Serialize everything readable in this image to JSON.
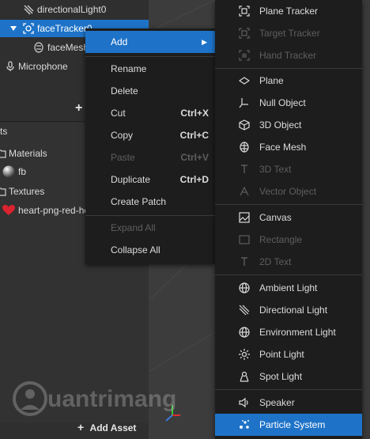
{
  "scene": {
    "items": [
      {
        "label": "directionalLight0"
      },
      {
        "label": "faceTracker0"
      },
      {
        "label": "faceMesh"
      },
      {
        "label": "Microphone"
      }
    ],
    "add_glyph": "+"
  },
  "assets": {
    "header_fragment": "ts",
    "items": [
      {
        "label": "Materials"
      },
      {
        "label": "fb"
      },
      {
        "label": "Textures"
      },
      {
        "label": "heart-png-red-he"
      }
    ],
    "add_label": "Add Asset"
  },
  "context_menu": {
    "add": "Add",
    "add_arrow": "▶",
    "items": [
      {
        "label": "Rename",
        "shortcut": ""
      },
      {
        "label": "Delete",
        "shortcut": ""
      },
      {
        "label": "Cut",
        "shortcut": "Ctrl+X"
      },
      {
        "label": "Copy",
        "shortcut": "Ctrl+C"
      },
      {
        "label": "Paste",
        "shortcut": "Ctrl+V"
      },
      {
        "label": "Duplicate",
        "shortcut": "Ctrl+D"
      },
      {
        "label": "Create Patch",
        "shortcut": ""
      },
      {
        "label": "Expand All",
        "shortcut": ""
      },
      {
        "label": "Collapse All",
        "shortcut": ""
      }
    ]
  },
  "submenu": {
    "items": [
      {
        "label": "Plane Tracker",
        "icon": "plane-tracker-icon"
      },
      {
        "label": "Target Tracker",
        "icon": "target-tracker-icon"
      },
      {
        "label": "Hand Tracker",
        "icon": "hand-tracker-icon"
      },
      {
        "label": "Plane",
        "icon": "plane-icon"
      },
      {
        "label": "Null Object",
        "icon": "null-object-icon"
      },
      {
        "label": "3D Object",
        "icon": "cube-icon"
      },
      {
        "label": "Face Mesh",
        "icon": "face-mesh-icon"
      },
      {
        "label": "3D Text",
        "icon": "text-icon"
      },
      {
        "label": "Vector Object",
        "icon": "vector-object-icon"
      },
      {
        "label": "Canvas",
        "icon": "canvas-icon"
      },
      {
        "label": "Rectangle",
        "icon": "rectangle-icon"
      },
      {
        "label": "2D Text",
        "icon": "text-icon"
      },
      {
        "label": "Ambient Light",
        "icon": "ambient-light-icon"
      },
      {
        "label": "Directional Light",
        "icon": "directional-light-icon"
      },
      {
        "label": "Environment Light",
        "icon": "environment-light-icon"
      },
      {
        "label": "Point Light",
        "icon": "point-light-icon"
      },
      {
        "label": "Spot Light",
        "icon": "spot-light-icon"
      },
      {
        "label": "Speaker",
        "icon": "speaker-icon"
      },
      {
        "label": "Particle System",
        "icon": "particle-system-icon"
      }
    ]
  },
  "watermark": "uantrimang",
  "colors": {
    "accent": "#1e73c8",
    "menu_bg": "#1d1d1d",
    "disabled": "#5e5e5e",
    "heart": "#d9232e"
  }
}
